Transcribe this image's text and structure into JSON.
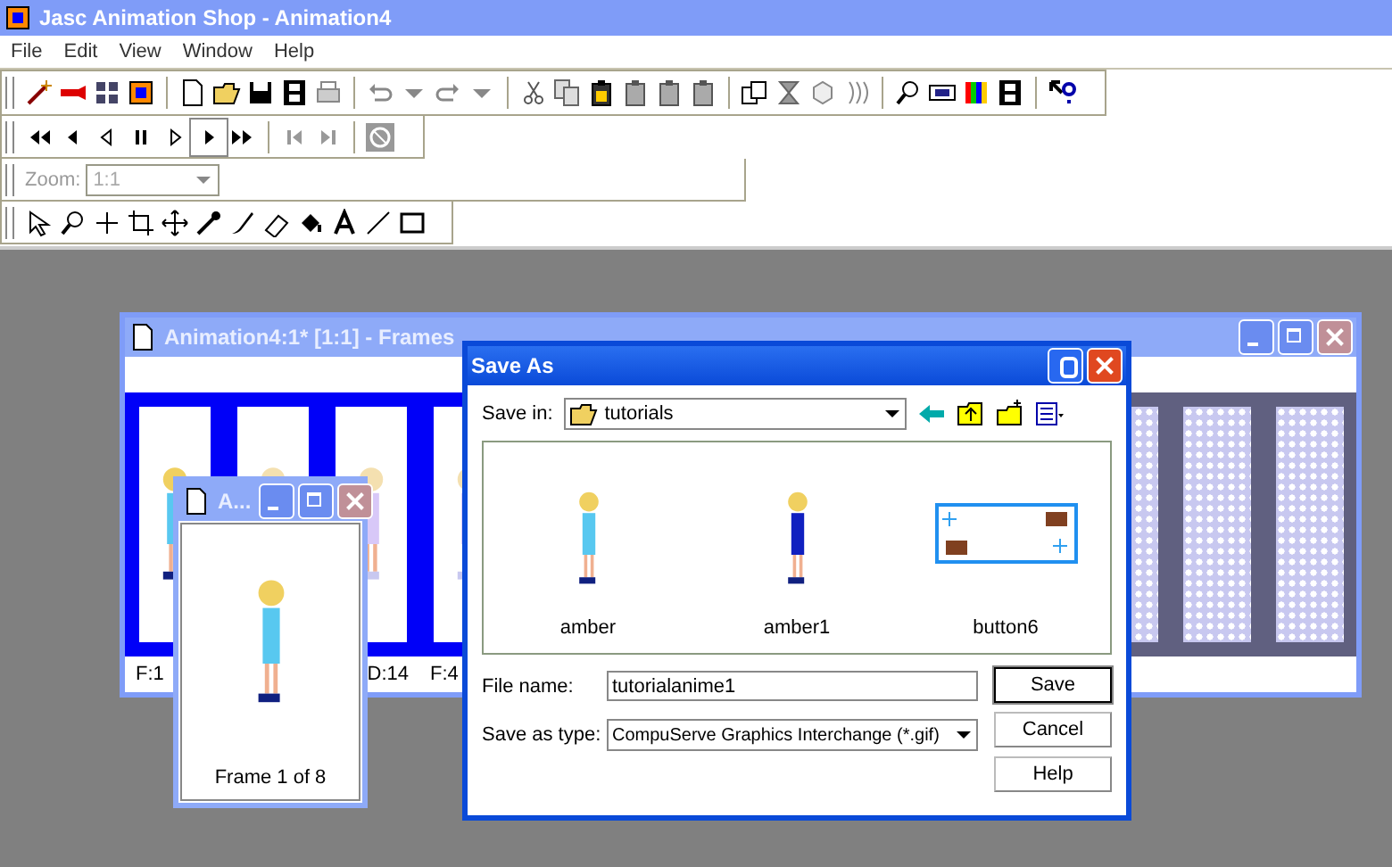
{
  "app": {
    "title": "Jasc Animation Shop - Animation4"
  },
  "menu": [
    {
      "label": "File"
    },
    {
      "label": "Edit"
    },
    {
      "label": "View"
    },
    {
      "label": "Window"
    },
    {
      "label": "Help"
    }
  ],
  "zoom_bar": {
    "label": "Zoom:",
    "value": "1:1",
    "disabled": true
  },
  "frames_window": {
    "title": "Animation4:1* [1:1] - Frames",
    "active": false,
    "frames": [
      {
        "kind": "sprite",
        "frame_label": "F:1"
      },
      {
        "kind": "faded"
      },
      {
        "kind": "faded",
        "duration_label": "D:14"
      },
      {
        "kind": "faded",
        "frame_label": "F:4"
      },
      {
        "kind": "transparent"
      },
      {
        "kind": "transparent"
      },
      {
        "kind": "transparent"
      }
    ]
  },
  "preview_window": {
    "title": "A...",
    "active": false,
    "caption": "Frame 1 of 8"
  },
  "save_dialog": {
    "title": "Save As",
    "active": true,
    "save_in": {
      "label": "Save in:",
      "value": "tutorials"
    },
    "files": [
      {
        "name": "amber",
        "kind": "figure-light"
      },
      {
        "name": "amber1",
        "kind": "figure-dark"
      },
      {
        "name": "button6",
        "kind": "button-image"
      }
    ],
    "file_name": {
      "label": "File name:",
      "value": "tutorialanime1"
    },
    "save_as_type": {
      "label": "Save as type:",
      "value": "CompuServe Graphics Interchange (*.gif)"
    },
    "buttons": [
      {
        "label": "Save",
        "default": true
      },
      {
        "label": "Cancel",
        "default": false
      },
      {
        "label": "Help",
        "default": false
      }
    ]
  }
}
